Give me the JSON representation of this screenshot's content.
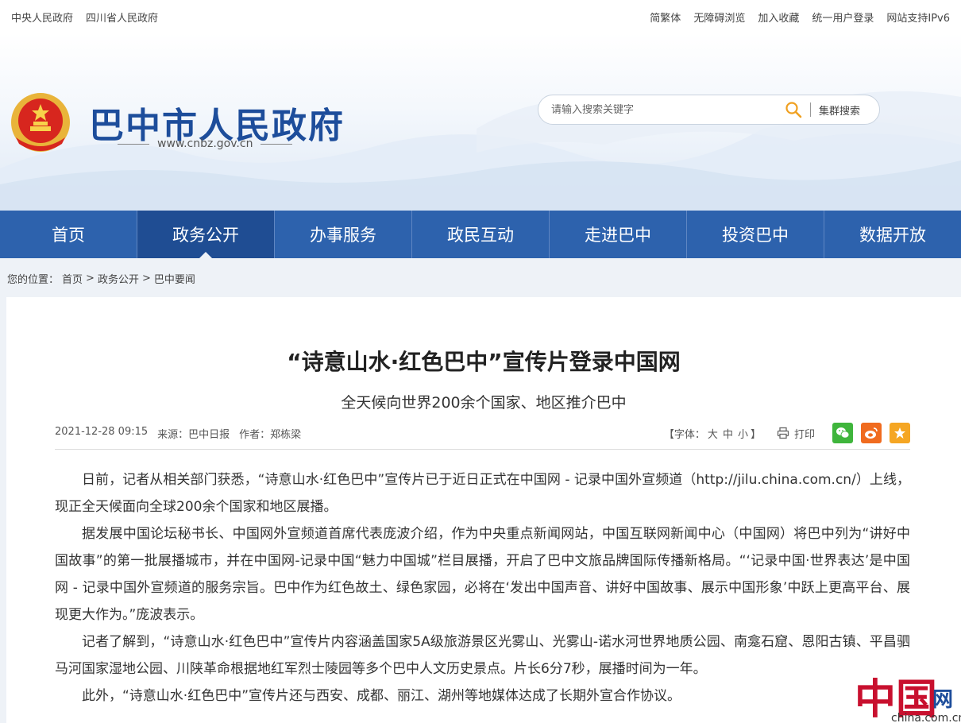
{
  "topbar": {
    "left": [
      "中央人民政府",
      "四川省人民政府"
    ],
    "right": [
      "简繁体",
      "无障碍浏览",
      "加入收藏",
      "统一用户登录",
      "网站支持IPv6"
    ]
  },
  "header": {
    "site_title": "巴中市人民政府",
    "site_url": "www.cnbz.gov.cn",
    "search_placeholder": "请输入搜索关键字",
    "cluster_search": "集群搜索"
  },
  "nav": {
    "items": [
      "首页",
      "政务公开",
      "办事服务",
      "政民互动",
      "走进巴中",
      "投资巴中",
      "数据开放"
    ],
    "active_index": 1
  },
  "breadcrumb": {
    "prefix": "您的位置：",
    "items": [
      "首页",
      "政务公开",
      "巴中要闻"
    ],
    "separator": ">"
  },
  "article": {
    "title": "“诗意山水·红色巴中”宣传片登录中国网",
    "subtitle": "全天候向世界200余个国家、地区推介巴中",
    "datetime": "2021-12-28 09:15",
    "source": "来源：巴中日报",
    "author": "作者：郑栋梁",
    "font_label_open": "【字体：",
    "font_large": "大",
    "font_medium": "中",
    "font_small": "小",
    "font_label_close": "】",
    "print_label": "打印",
    "paragraphs": [
      "日前，记者从相关部门获悉，“诗意山水·红色巴中”宣传片已于近日正式在中国网 - 记录中国外宣频道（http://jilu.china.com.cn/）上线，现正全天候面向全球200余个国家和地区展播。",
      "据发展中国论坛秘书长、中国网外宣频道首席代表庞波介绍，作为中央重点新闻网站，中国互联网新闻中心（中国网）将巴中列为“讲好中国故事”的第一批展播城市，并在中国网-记录中国“魅力中国城”栏目展播，开启了巴中文旅品牌国际传播新格局。“‘记录中国·世界表达’是中国网 - 记录中国外宣频道的服务宗旨。巴中作为红色故土、绿色家园，必将在‘发出中国声音、讲好中国故事、展示中国形象’中跃上更高平台、展现更大作为。”庞波表示。",
      "记者了解到，“诗意山水·红色巴中”宣传片内容涵盖国家5A级旅游景区光雾山、光雾山-诺水河世界地质公园、南龛石窟、恩阳古镇、平昌驷马河国家湿地公园、川陕革命根据地红军烈士陵园等多个巴中人文历史景点。片长6分7秒，展播时间为一年。",
      "此外，“诗意山水·红色巴中”宣传片还与西安、成都、丽江、湖州等地媒体达成了长期外宣合作协议。"
    ]
  },
  "watermark": {
    "mark": "中国",
    "wang": "网",
    "domain": "china.com.cn"
  },
  "colors": {
    "nav_bg": "#2d62ad",
    "nav_active": "#1f4d93",
    "title_blue": "#1d4d9b"
  }
}
